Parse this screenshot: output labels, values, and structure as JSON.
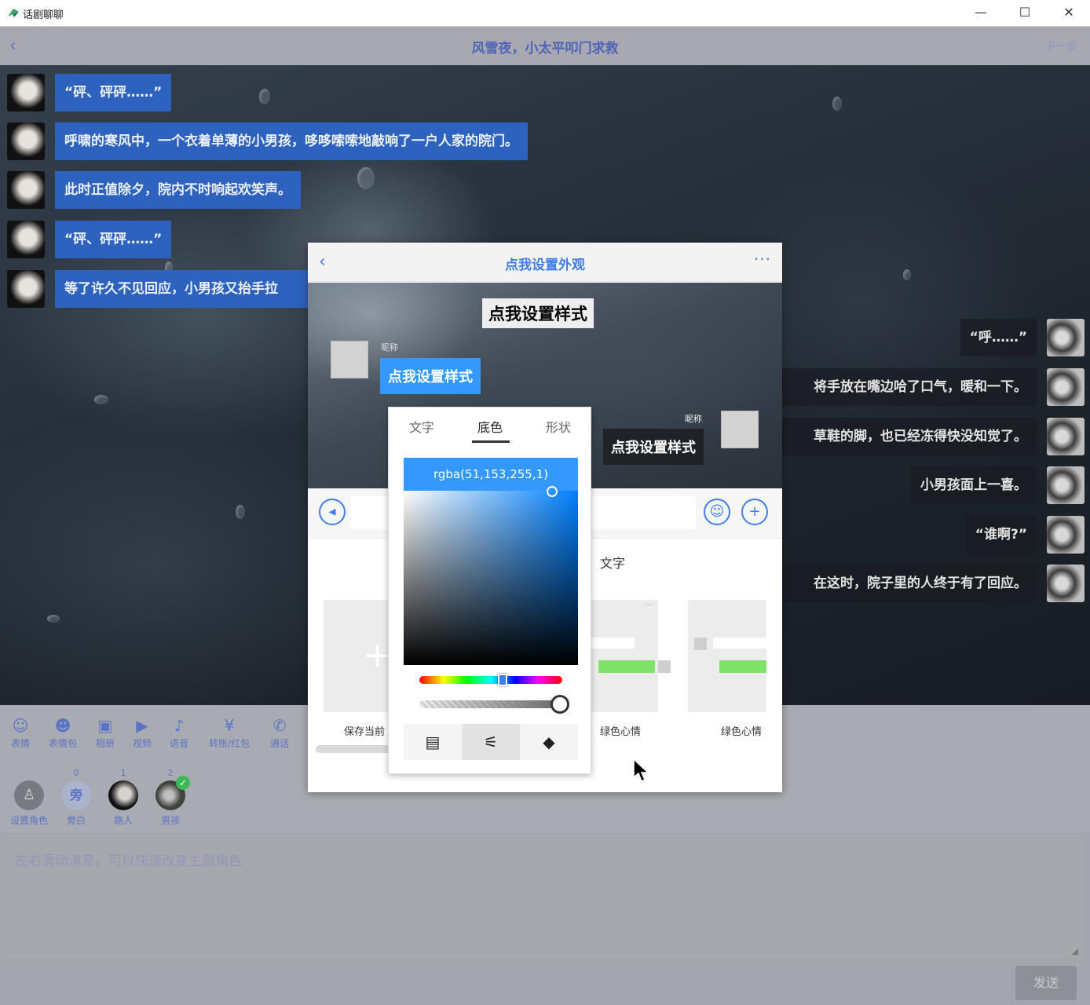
{
  "window": {
    "title": "话剧聊聊",
    "minimize": "—",
    "maximize": "☐",
    "close": "✕"
  },
  "nav": {
    "back_icon": "chevron-left-icon",
    "back_glyph": "‹",
    "title": "风雪夜，小太平叩门求救",
    "next": "下一步"
  },
  "chat": {
    "left_messages": [
      "“砰、砰砰……”",
      "呼啸的寒风中，一个衣着单薄的小男孩，哆哆嗦嗦地敲响了一户人家的院门。",
      "此时正值除夕，院内不时响起欢笑声。",
      "“砰、砰砰……”",
      "等了许久不见回应，小男孩又抬手拉"
    ],
    "right_messages": [
      "“呼……”",
      "将手放在嘴边哈了口气，暖和一下。",
      "草鞋的脚，也已经冻得快没知觉了。",
      "小男孩面上一喜。",
      "“谁啊?”",
      "在这时，院子里的人终于有了回应。"
    ]
  },
  "toolbar": {
    "items": [
      {
        "icon": "emoji-icon",
        "glyph": "☺",
        "label": "表情"
      },
      {
        "icon": "emoji-pack-icon",
        "glyph": "☻",
        "label": "表情包"
      },
      {
        "icon": "image-icon",
        "glyph": "▣",
        "label": "相册"
      },
      {
        "icon": "video-icon",
        "glyph": "▶",
        "label": "视频"
      },
      {
        "icon": "microphone-icon",
        "glyph": "♪",
        "label": "语音"
      },
      {
        "icon": "yen-icon",
        "glyph": "¥",
        "label": "转账/红包"
      },
      {
        "icon": "phone-icon",
        "glyph": "✆",
        "label": "通话"
      }
    ]
  },
  "roles": [
    {
      "count": "",
      "label": "设置角色",
      "badge": "",
      "color": "#777a80"
    },
    {
      "count": "0",
      "label": "旁白",
      "badge": "旁",
      "color": "#aab2cc"
    },
    {
      "count": "1",
      "label": "路人",
      "badge": "",
      "color": "#1b1b1b"
    },
    {
      "count": "2",
      "label": "男孩",
      "badge": "",
      "color": "#4b4f4a"
    }
  ],
  "input": {
    "placeholder": "左右滑动消息，可以快速改变主副角色"
  },
  "send_label": "发送",
  "dialog": {
    "title": "点我设置外观",
    "more_glyph": "···",
    "preview": {
      "top_label": "点我设置样式",
      "left_nickname": "昵称",
      "left_label": "点我设置样式",
      "right_nickname": "昵称",
      "right_label": "点我设置样式"
    },
    "tab_text": "文字",
    "cards": [
      {
        "label": "保存当前"
      },
      {
        "label": "绿色心情"
      },
      {
        "label": "绿色心情"
      }
    ]
  },
  "picker": {
    "tabs": [
      "文字",
      "底色",
      "形状"
    ],
    "active_tab": 1,
    "rgba_value": "rgba(51,153,255,1)",
    "color": "#3399ff",
    "hue_fraction": 0.58,
    "alpha": 1,
    "modes": [
      {
        "icon": "palette-swatch-icon",
        "glyph": "▤"
      },
      {
        "icon": "sliders-icon",
        "glyph": "⚟"
      },
      {
        "icon": "paint-bucket-icon",
        "glyph": "◆"
      }
    ],
    "selected_mode": 1
  }
}
